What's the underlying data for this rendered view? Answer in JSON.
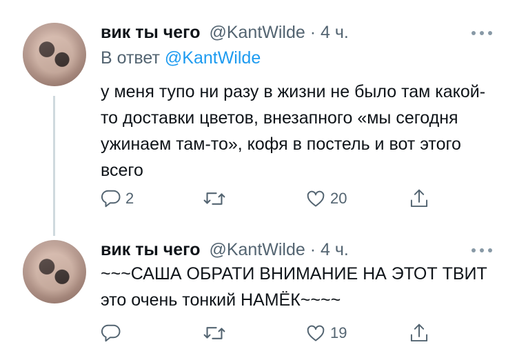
{
  "tweets": [
    {
      "author": {
        "name": "вик ты чего",
        "handle": "@KantWilde"
      },
      "separator": "·",
      "time": "4 ч.",
      "reply_prefix": "В ответ",
      "reply_to": "@KantWilde",
      "text": "у меня тупо ни разу в жизни не было там какой-то доставки цветов, внезапного «мы сегодня ужинаем там-то», кофя в постель и вот этого всего",
      "actions": {
        "reply_count": "2",
        "retweet_count": "",
        "like_count": "20"
      }
    },
    {
      "author": {
        "name": "вик ты чего",
        "handle": "@KantWilde"
      },
      "separator": "·",
      "time": "4 ч.",
      "text": "~~~САША ОБРАТИ ВНИМАНИЕ НА ЭТОТ ТВИТ это очень тонкий НАМЁК~~~~",
      "actions": {
        "reply_count": "",
        "retweet_count": "",
        "like_count": "19"
      }
    }
  ],
  "icons": {
    "reply": "reply-icon",
    "retweet": "retweet-icon",
    "like": "heart-icon",
    "share": "share-icon",
    "more": "more-icon"
  },
  "colors": {
    "link": "#1d9bf0",
    "muted": "#536471",
    "text": "#0f1419",
    "thread_line": "#cfd9de"
  }
}
